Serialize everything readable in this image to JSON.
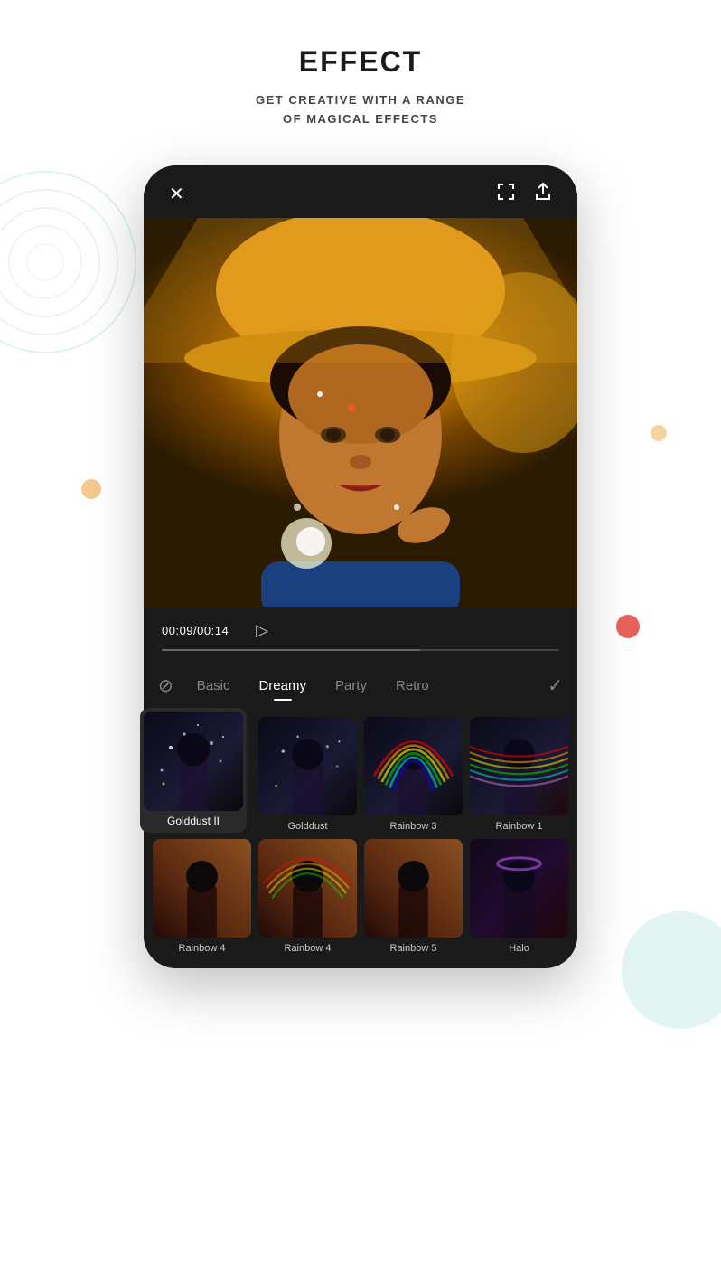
{
  "header": {
    "title": "EFFECT",
    "subtitle": "GET CREATIVE WITH A RANGE\nOF MAGICAL EFFECTS"
  },
  "topbar": {
    "close_icon": "✕",
    "fullscreen_icon": "⛶",
    "share_icon": "⬆"
  },
  "timeline": {
    "current_time": "00:09/00:14",
    "play_icon": "▷"
  },
  "tabs": {
    "no_effect_icon": "⊘",
    "items": [
      {
        "label": "Basic",
        "active": false
      },
      {
        "label": "Dreamy",
        "active": true
      },
      {
        "label": "Party",
        "active": false
      },
      {
        "label": "Retro",
        "active": false
      }
    ],
    "confirm_icon": "✓"
  },
  "effects_row1": [
    {
      "id": "golddust2",
      "label": "Golddust II",
      "selected": true,
      "has_sparkles": true,
      "has_rainbow": false
    },
    {
      "id": "golddust",
      "label": "Golddust",
      "selected": false,
      "has_sparkles": true,
      "has_rainbow": false
    },
    {
      "id": "rainbow3",
      "label": "Rainbow 3",
      "selected": false,
      "has_sparkles": false,
      "has_rainbow": true
    },
    {
      "id": "rainbow1",
      "label": "Rainbow 1",
      "selected": false,
      "has_sparkles": false,
      "has_rainbow": true
    }
  ],
  "effects_row2": [
    {
      "id": "rainbow4a",
      "label": "Rainbow 4",
      "selected": false,
      "has_sparkles": false,
      "has_rainbow": false
    },
    {
      "id": "rainbow4b",
      "label": "Rainbow 4",
      "selected": false,
      "has_sparkles": false,
      "has_rainbow": true
    },
    {
      "id": "rainbow5",
      "label": "Rainbow 5",
      "selected": false,
      "has_sparkles": false,
      "has_rainbow": false
    },
    {
      "id": "halo",
      "label": "Halo",
      "selected": false,
      "has_sparkles": false,
      "has_rainbow": false
    }
  ]
}
